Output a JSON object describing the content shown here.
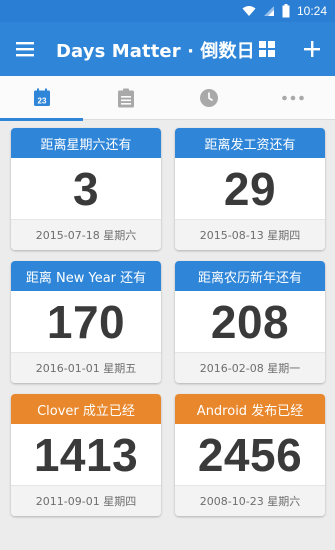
{
  "status": {
    "time": "10:24"
  },
  "app": {
    "title": "Days Matter · 倒数日"
  },
  "tabs": [
    {
      "name": "calendar",
      "label": "23",
      "icon": "calendar-icon",
      "active": true
    },
    {
      "name": "list",
      "icon": "clipboard-icon",
      "active": false
    },
    {
      "name": "clock",
      "icon": "clock-icon",
      "active": false
    },
    {
      "name": "more",
      "icon": "more-icon",
      "active": false
    }
  ],
  "colors": {
    "primary": "#2f86d8",
    "status_bar": "#2a7fd4",
    "future_header": "#2f86d8",
    "past_header": "#e8872b"
  },
  "cards": [
    {
      "title": "距离星期六还有",
      "days": "3",
      "date": "2015-07-18 星期六",
      "kind": "future"
    },
    {
      "title": "距离发工资还有",
      "days": "29",
      "date": "2015-08-13 星期四",
      "kind": "future"
    },
    {
      "title": "距离 New Year 还有",
      "days": "170",
      "date": "2016-01-01 星期五",
      "kind": "future"
    },
    {
      "title": "距离农历新年还有",
      "days": "208",
      "date": "2016-02-08 星期一",
      "kind": "future"
    },
    {
      "title": "Clover 成立已经",
      "days": "1413",
      "date": "2011-09-01 星期四",
      "kind": "past"
    },
    {
      "title": "Android 发布已经",
      "days": "2456",
      "date": "2008-10-23 星期六",
      "kind": "past"
    }
  ]
}
